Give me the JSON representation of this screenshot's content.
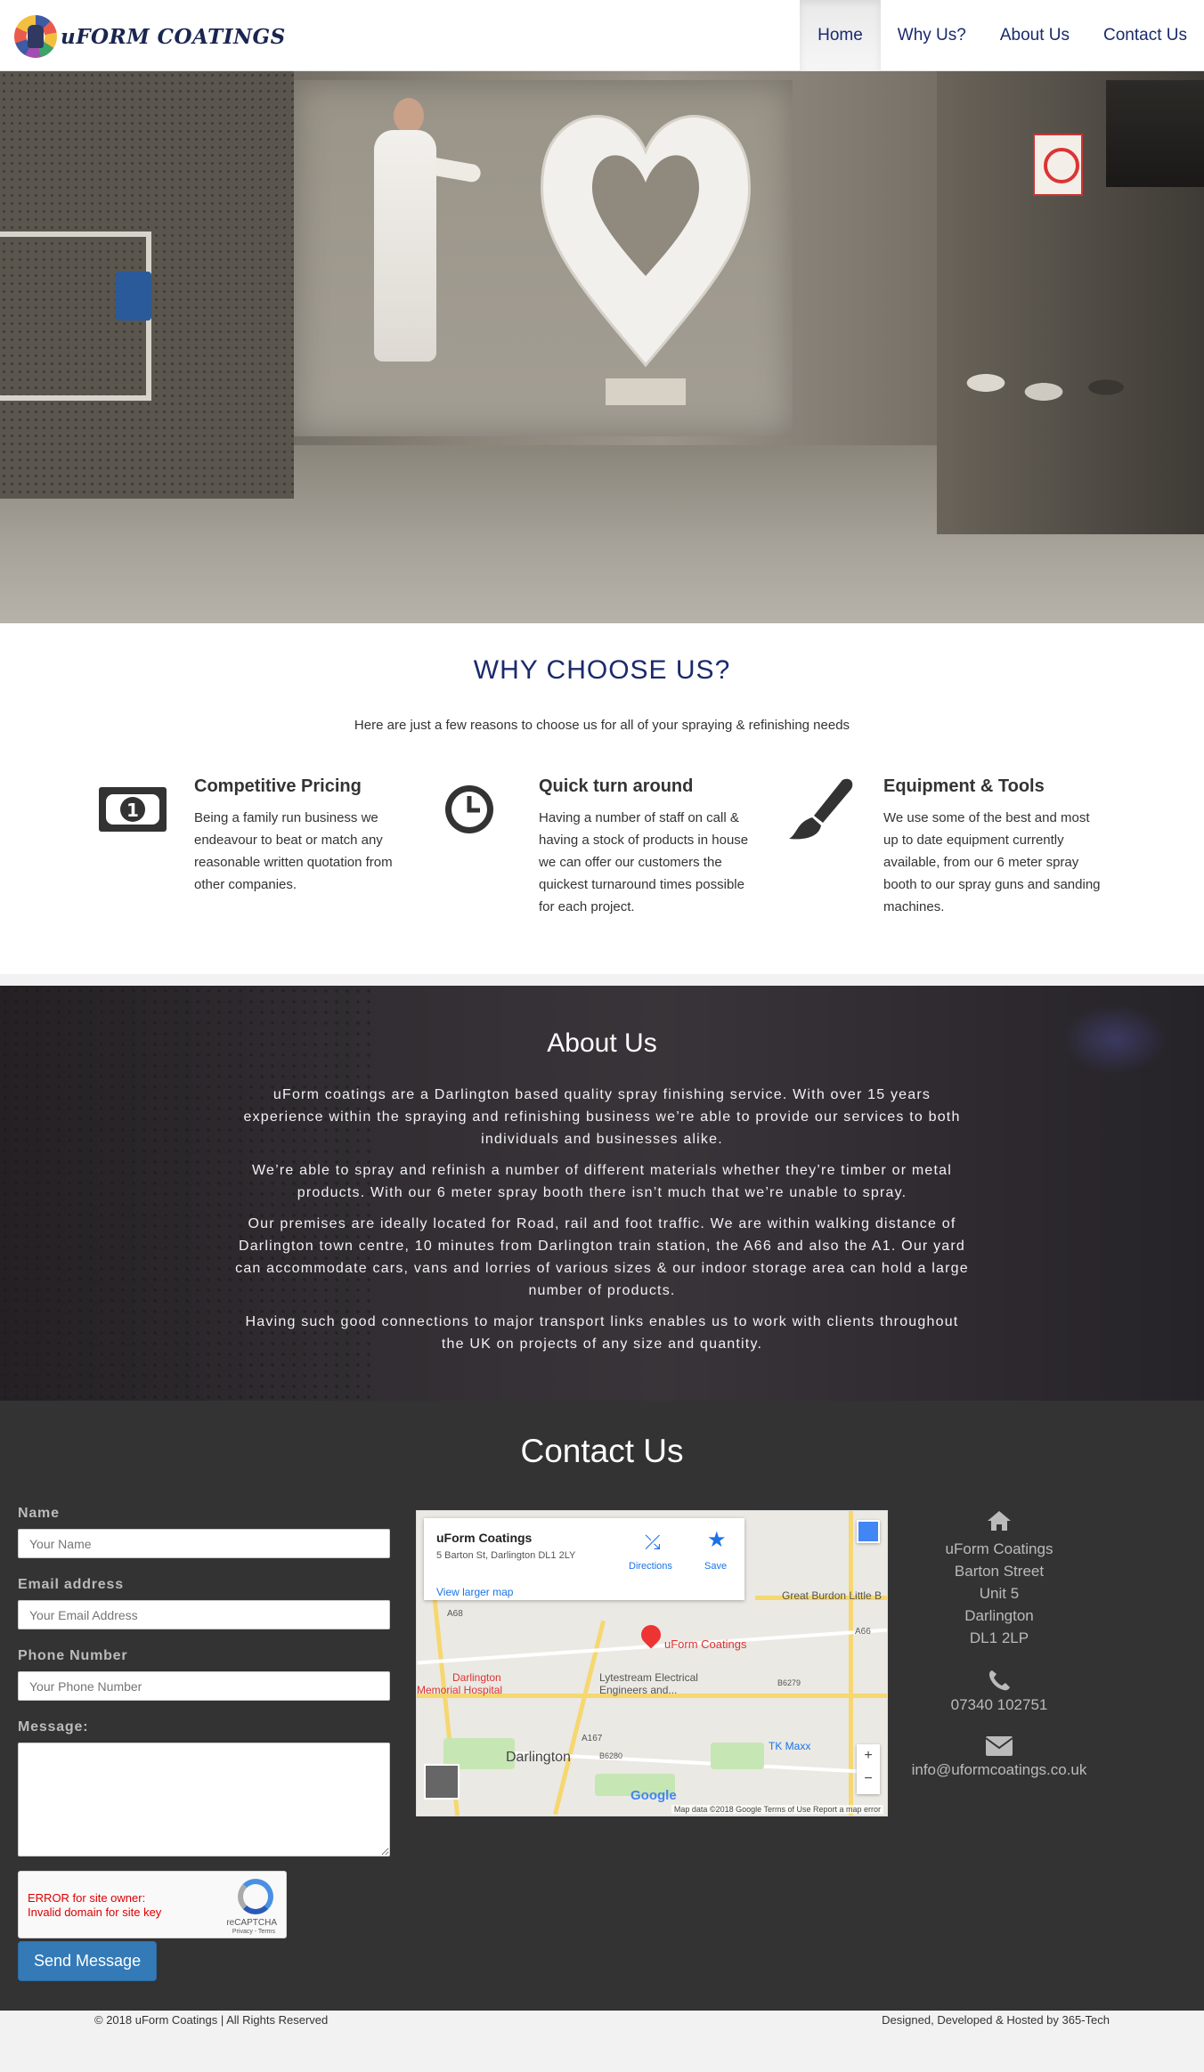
{
  "brand": {
    "name": "uFORM COATINGS",
    "logo_icon": "spray-painter-logo"
  },
  "nav": {
    "items": [
      {
        "label": "Home",
        "active": true
      },
      {
        "label": "Why Us?",
        "active": false
      },
      {
        "label": "About Us",
        "active": false
      },
      {
        "label": "Contact Us",
        "active": false
      }
    ]
  },
  "hero": {
    "image": "spray-booth-worker-with-heart-photo"
  },
  "why": {
    "title": "WHY CHOOSE US?",
    "subtitle": "Here are just a few reasons to choose us for all of your spraying & refinishing needs",
    "features": [
      {
        "icon": "money-icon",
        "title": "Competitive Pricing",
        "text": "Being a family run business we endeavour to beat or match any reasonable written quotation from other companies."
      },
      {
        "icon": "clock-icon",
        "title": "Quick turn around",
        "text": "Having a number of staff on call & having a stock of products in house we can offer our customers the quickest turnaround times possible for each project."
      },
      {
        "icon": "paintbrush-icon",
        "title": "Equipment & Tools",
        "text": "We use some of the best and most up to date equipment currently available, from our 6 meter spray booth to our spray guns and sanding machines."
      }
    ]
  },
  "about": {
    "title": "About Us",
    "paragraphs": [
      "uForm coatings are a Darlington based quality spray finishing service. With over 15 years experience within the spraying and refinishing business we’re able to provide our services to both individuals and businesses alike.",
      "We’re able to spray and refinish a number of different materials whether they’re timber or metal products. With our 6 meter spray booth there isn’t much that we’re unable to spray.",
      "Our premises are ideally located for Road, rail and foot traffic. We are within walking distance of Darlington town centre, 10 minutes from Darlington train station, the A66 and also the A1. Our yard can accommodate cars, vans and lorries of various sizes & our indoor storage area can hold a large number of products.",
      "Having such good connections to major transport links enables us to work with clients throughout the UK on projects of any size and quantity."
    ]
  },
  "contact": {
    "title": "Contact Us",
    "form": {
      "name_label": "Name",
      "name_placeholder": "Your Name",
      "email_label": "Email address",
      "email_placeholder": "Your Email Address",
      "phone_label": "Phone Number",
      "phone_placeholder": "Your Phone Number",
      "message_label": "Message:",
      "recaptcha_error_1": "ERROR for site owner:",
      "recaptcha_error_2": "Invalid domain for site key",
      "recaptcha_label": "reCAPTCHA",
      "recaptcha_terms": "Privacy - Terms",
      "send_label": "Send Message"
    },
    "map": {
      "place_name": "uForm Coatings",
      "place_address": "5 Barton St, Darlington DL1 2LY",
      "directions": "Directions",
      "save": "Save",
      "larger_map": "View larger map",
      "pin_label": "uForm Coatings",
      "labels": {
        "burdon": "Great Burdon Little B",
        "hospital_1": "Darlington",
        "hospital_2": "Memorial Hospital",
        "lytestream_1": "Lytestream Electrical",
        "lytestream_2": "Engineers and...",
        "town": "Darlington",
        "tkmaxx": "TK Maxx",
        "a68": "A68",
        "a66": "A66",
        "a167": "A167",
        "b6279": "B6279",
        "b6280": "B6280"
      },
      "google": "Google",
      "attribution": "Map data ©2018 Google   Terms of Use   Report a map error",
      "zoom_in": "+",
      "zoom_out": "−"
    },
    "info": {
      "address_lines": [
        "uForm Coatings",
        "Barton Street",
        "Unit 5",
        "Darlington",
        "DL1 2LP"
      ],
      "phone": "07340 102751",
      "email": "info@uformcoatings.co.uk",
      "icons": [
        "home-icon",
        "phone-icon",
        "envelope-icon"
      ]
    }
  },
  "footer": {
    "copyright": "© 2018 uForm Coatings | All Rights Reserved",
    "credit": "Designed, Developed & Hosted by 365-Tech"
  },
  "colors": {
    "navy": "#1a2a6c",
    "button_blue": "#337ab7",
    "contact_bg": "#333333"
  }
}
